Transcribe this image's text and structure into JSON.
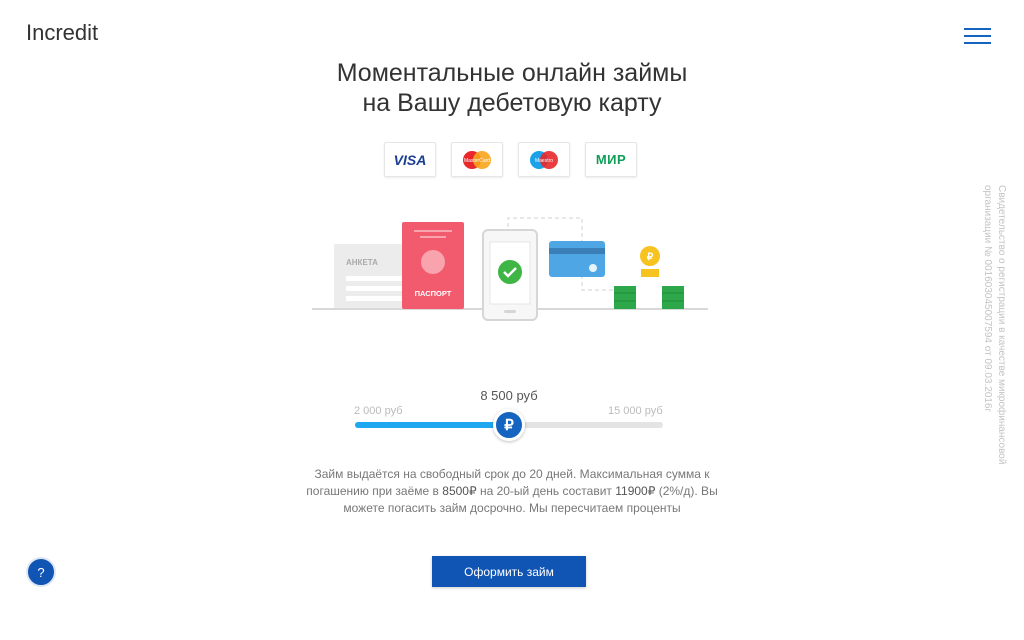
{
  "header": {
    "logo": "Incredit",
    "menu_icon": "hamburger-menu-icon"
  },
  "headline": {
    "line1": "Моментальные онлайн займы",
    "line2": "на Вашу дебетовую карту"
  },
  "payment_cards": [
    {
      "name": "VISA"
    },
    {
      "name": "MasterCard"
    },
    {
      "name": "Maestro"
    },
    {
      "name": "МИР"
    }
  ],
  "illustration": {
    "form_label": "АНКЕТА",
    "passport_label": "ПАСПОРТ",
    "coin_symbol": "₽"
  },
  "slider": {
    "current": "8 500 руб",
    "min_label": "2 000 руб",
    "max_label": "15 000 руб",
    "thumb_symbol": "₽",
    "value": 8500,
    "min": 2000,
    "max": 15000
  },
  "description": {
    "part1": "Займ выдаётся на свободный срок до 20 дней. Максимальная сумма к погашению при заёме в",
    "amount": "8500₽",
    "part2": "на 20-ый день составит",
    "total": "11900₽",
    "part3": "(2%/д). Вы можете погасить займ досрочно. Мы пересчитаем проценты"
  },
  "cta_label": "Оформить займ",
  "help_label": "?",
  "side_note": "Свидетельство о регистрации в качестве микрофинансовой организации № 001603045007594 от 09.03.2016г",
  "colors": {
    "primary": "#1054b4",
    "slider_fill": "#1ea8f0",
    "passport": "#f25b6e",
    "check": "#3eb545",
    "coins": "#2ca84a"
  }
}
